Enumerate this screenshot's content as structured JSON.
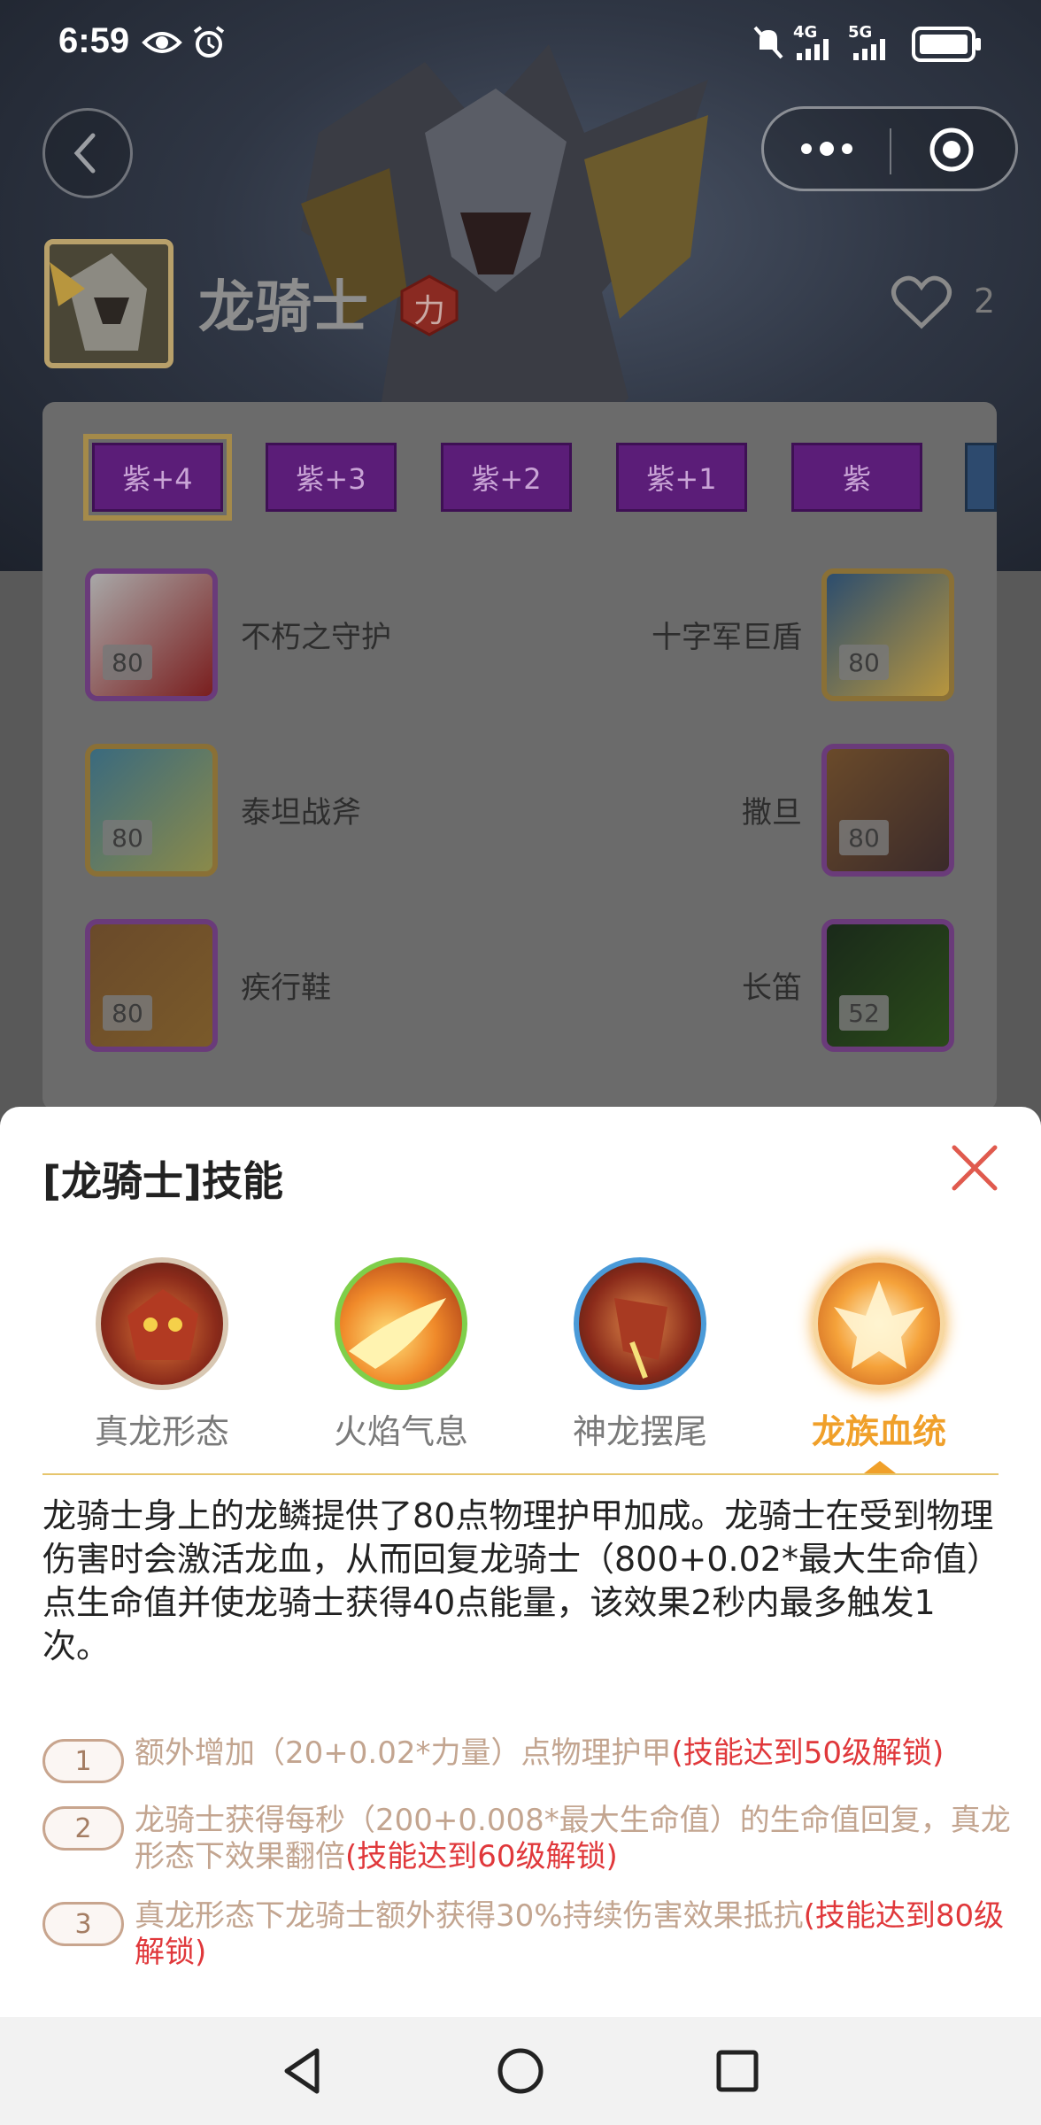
{
  "status_bar": {
    "time": "6:59",
    "network_1": "4G",
    "network_2": "5G"
  },
  "hero": {
    "name": "龙骑士",
    "attribute": "力",
    "likes": "2"
  },
  "equipment": {
    "grades": [
      "紫+4",
      "紫+3",
      "紫+2",
      "紫+1",
      "紫"
    ],
    "selected_grade": "紫+4",
    "items": [
      {
        "name": "不朽之守护",
        "level": "80"
      },
      {
        "name": "十字军巨盾",
        "level": "80"
      },
      {
        "name": "泰坦战斧",
        "level": "80"
      },
      {
        "name": "撒旦",
        "level": "80"
      },
      {
        "name": "疾行鞋",
        "level": "80"
      },
      {
        "name": "长笛",
        "level": "52"
      }
    ]
  },
  "skill_sheet": {
    "title": "[龙骑士]技能",
    "tabs": [
      "真龙形态",
      "火焰气息",
      "神龙摆尾",
      "龙族血统"
    ],
    "active_tab": "龙族血统",
    "description": "龙骑士身上的龙鳞提供了80点物理护甲加成。龙骑士在受到物理伤害时会激活龙血，从而回复龙骑士（800+0.02*最大生命值）点生命值并使龙骑士获得40点能量，该效果2秒内最多触发1次。",
    "bonuses": [
      {
        "num": "1",
        "text": "额外增加（20+0.02*力量）点物理护甲",
        "unlock": "(技能达到50级解锁)"
      },
      {
        "num": "2",
        "text": "龙骑士获得每秒（200+0.008*最大生命值）的生命值回复，真龙形态下效果翻倍",
        "unlock": "(技能达到60级解锁)"
      },
      {
        "num": "3",
        "text": "真龙形态下龙骑士额外获得30%持续伤害效果抵抗",
        "unlock": "(技能达到80级解锁)"
      }
    ]
  },
  "colors": {
    "accent": "#f0a02a",
    "unlock_red": "#e0383b",
    "close_red": "#e05a4e",
    "grade_purple": "#5b1d78"
  },
  "icons": {
    "back": "chevron-left-icon",
    "more": "more-dots-icon",
    "target": "target-icon",
    "like": "heart-icon",
    "close": "close-icon"
  }
}
